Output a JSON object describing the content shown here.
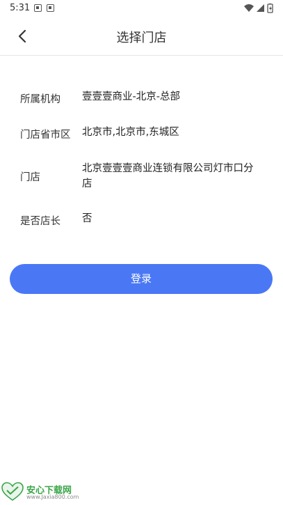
{
  "status_bar": {
    "time": "5:31"
  },
  "nav": {
    "title": "选择门店"
  },
  "info": {
    "rows": [
      {
        "label": "所属机构",
        "value": "壹壹壹商业-北京-总部"
      },
      {
        "label": "门店省市区",
        "value": "北京市,北京市,东城区"
      },
      {
        "label": "门店",
        "value": "北京壹壹壹商业连锁有限公司灯市口分店"
      },
      {
        "label": "是否店长",
        "value": "否"
      }
    ]
  },
  "login_button": {
    "label": "登录"
  },
  "watermark": {
    "name": "安心下载网",
    "url": "www.Jaxia800.com"
  },
  "colors": {
    "accent": "#4a78f5",
    "watermark_green": "#3aa548"
  }
}
